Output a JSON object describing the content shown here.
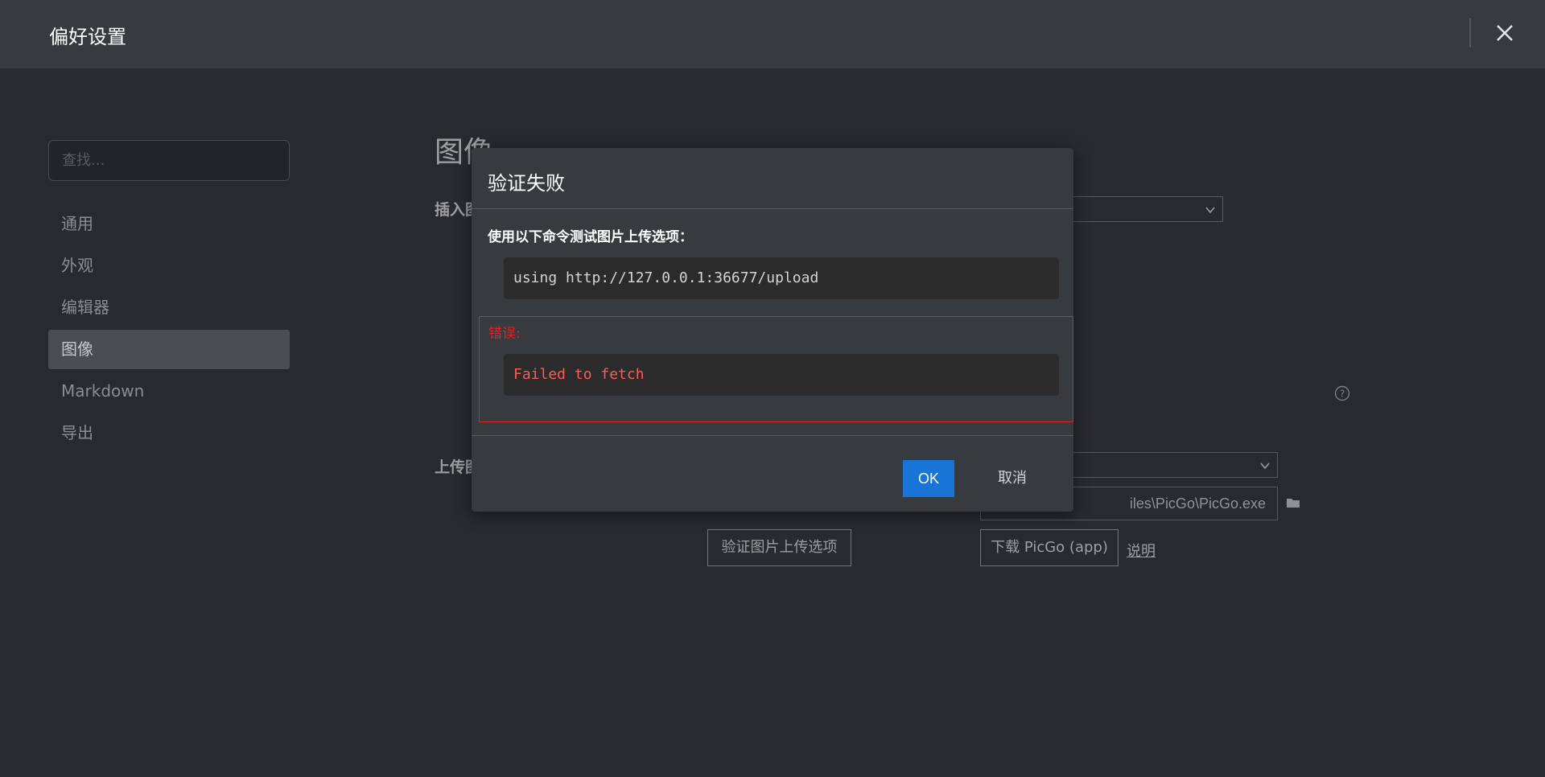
{
  "window": {
    "title": "偏好设置"
  },
  "sidebar": {
    "search_placeholder": "查找...",
    "items": [
      {
        "label": "通用"
      },
      {
        "label": "外观"
      },
      {
        "label": "编辑器"
      },
      {
        "label": "图像",
        "active": true
      },
      {
        "label": "Markdown"
      },
      {
        "label": "导出"
      }
    ]
  },
  "main": {
    "section_title": "图像",
    "insert_label_partial": "插入图",
    "upload_label_partial": "上传图",
    "picgo_path_visible": "iles\\PicGo\\PicGo.exe",
    "validate_button": "验证图片上传选项",
    "download_button": "下载 PicGo (app)",
    "help_link": "说明"
  },
  "dialog": {
    "title": "验证失败",
    "description": "使用以下命令测试图片上传选项：",
    "command": "using http://127.0.0.1:36677/upload",
    "error_label": "错误:",
    "error_message": "Failed to fetch",
    "ok_button": "OK",
    "cancel_button": "取消"
  },
  "colors": {
    "accent": "#1874d6",
    "error": "#d9262b"
  }
}
